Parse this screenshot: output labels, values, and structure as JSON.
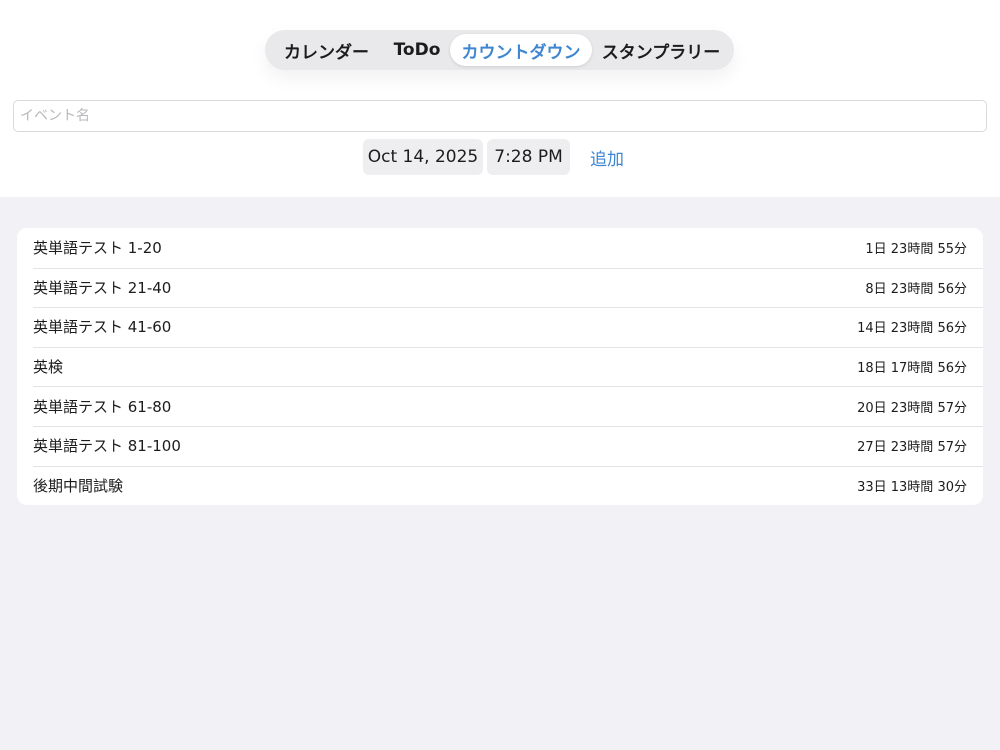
{
  "tabs": [
    {
      "label": "カレンダー",
      "active": false
    },
    {
      "label": "ToDo",
      "active": false
    },
    {
      "label": "カウントダウン",
      "active": true
    },
    {
      "label": "スタンプラリー",
      "active": false
    }
  ],
  "event_input": {
    "placeholder": "イベント名",
    "value": ""
  },
  "date_picker": {
    "value": "Oct 14, 2025"
  },
  "time_picker": {
    "value": "7:28 PM"
  },
  "add_button": {
    "label": "追加"
  },
  "countdowns": [
    {
      "title": "英単語テスト 1-20",
      "remaining": "1日 23時間 55分"
    },
    {
      "title": "英単語テスト 21-40",
      "remaining": "8日 23時間 56分"
    },
    {
      "title": "英単語テスト 41-60",
      "remaining": "14日 23時間 56分"
    },
    {
      "title": "英検",
      "remaining": "18日 17時間 56分"
    },
    {
      "title": "英単語テスト 61-80",
      "remaining": "20日 23時間 57分"
    },
    {
      "title": "英単語テスト 81-100",
      "remaining": "27日 23時間 57分"
    },
    {
      "title": "後期中間試験",
      "remaining": "33日 13時間 30分"
    }
  ],
  "colors": {
    "accent": "#3f86d1",
    "background": "#f2f1f6",
    "card": "#ffffff",
    "segment_track": "#e9e9eb"
  }
}
